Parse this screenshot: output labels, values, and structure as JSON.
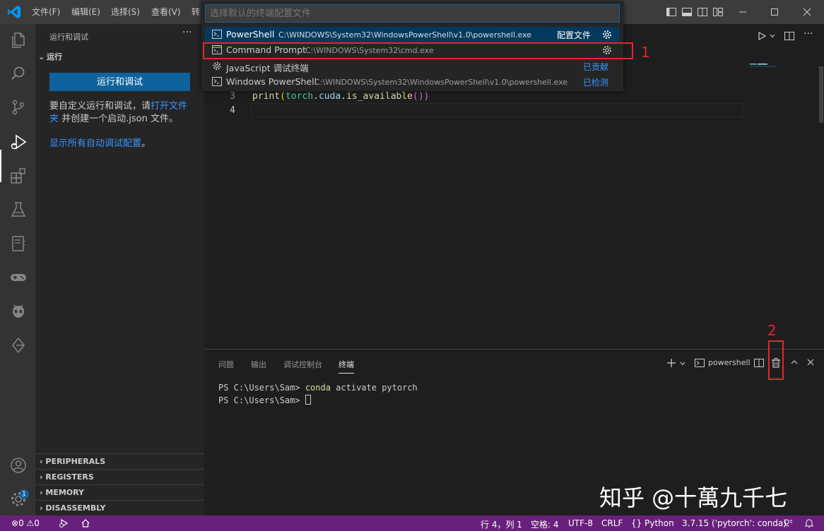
{
  "titlebar": {
    "menus": [
      "文件(F)",
      "编辑(E)",
      "选择(S)",
      "查看(V)",
      "转"
    ]
  },
  "quickpick": {
    "placeholder": "选择默认的终端配置文件",
    "items": [
      {
        "label": "PowerShell",
        "desc": "C:\\WINDOWS\\System32\\WindowsPowerShell\\v1.0\\powershell.exe",
        "right": "配置文件",
        "icon": "terminal-powershell-icon"
      },
      {
        "label": "Command Prompt",
        "desc": "C:\\WINDOWS\\System32\\cmd.exe",
        "right": "",
        "icon": "terminal-cmd-icon"
      },
      {
        "label": "JavaScript 调试终端",
        "desc": "",
        "right": "已贡献",
        "icon": "debug-gear-icon"
      },
      {
        "label": "Windows PowerShell",
        "desc": "C:\\WINDOWS\\System32\\WindowsPowerShell\\v1.0\\powershell.exe",
        "right": "已检测",
        "icon": "terminal-powershell-icon"
      }
    ]
  },
  "sidebar": {
    "title": "运行和调试",
    "more": "···",
    "run_header": "运行",
    "run_button": "运行和调试",
    "desc_prefix": "要自定义运行和调试，请",
    "desc_link": "打开文件夹",
    "desc_suffix": " 并创建一个启动.json 文件。",
    "show_configs_link": "显示所有自动调试配置",
    "show_configs_suffix": "。",
    "sections": [
      "PERIPHERALS",
      "REGISTERS",
      "MEMORY",
      "DISASSEMBLY"
    ]
  },
  "editor": {
    "line_numbers": [
      "3",
      "4"
    ],
    "code": {
      "func": "print",
      "open": "(",
      "obj": "torch",
      "dot1": ".",
      "attr": "cuda",
      "dot2": ".",
      "method": "is_available",
      "close": "())"
    }
  },
  "panel": {
    "tabs": [
      "问题",
      "输出",
      "调试控制台",
      "终端"
    ],
    "terminal_name": "powershell",
    "lines": [
      {
        "prompt": "PS C:\\Users\\Sam> ",
        "cmd": "conda",
        "args": " activate pytorch"
      },
      {
        "prompt": "PS C:\\Users\\Sam> ",
        "cmd": "",
        "args": ""
      }
    ]
  },
  "statusbar": {
    "errors": "0",
    "warnings": "0",
    "position": "行 4，列 1",
    "spaces": "空格: 4",
    "encoding": "UTF-8",
    "eol": "CRLF",
    "language": "Python",
    "interpreter": "3.7.15 ('pytorch': conda)"
  },
  "account_badge": "1",
  "annotations": [
    "1",
    "2"
  ],
  "watermark": "知乎 @十萬九千七",
  "colors": {
    "statusbar": "#68217a",
    "accent": "#0e639c",
    "annotation": "#e5262a"
  }
}
